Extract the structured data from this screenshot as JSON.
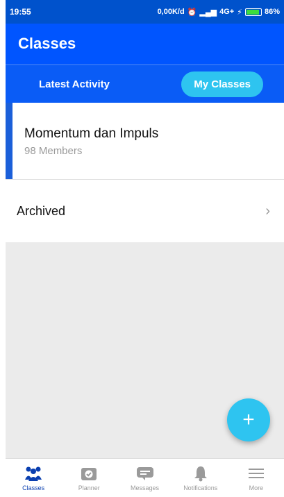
{
  "status_bar": {
    "time": "19:55",
    "network_speed": "0,00K/d",
    "network_type": "4G+",
    "battery": "86%"
  },
  "app_bar": {
    "title": "Classes"
  },
  "tabs": [
    {
      "label": "Latest Activity",
      "active": false
    },
    {
      "label": "My Classes",
      "active": true
    }
  ],
  "class_card": {
    "name": "Momentum dan Impuls",
    "members": "98 Members"
  },
  "archived": {
    "label": "Archived"
  },
  "fab": {
    "icon": "plus-icon",
    "symbol": "+"
  },
  "bottom_nav": [
    {
      "label": "Classes",
      "icon": "classes-icon",
      "active": true
    },
    {
      "label": "Planner",
      "icon": "planner-icon",
      "active": false
    },
    {
      "label": "Messages",
      "icon": "messages-icon",
      "active": false
    },
    {
      "label": "Notifications",
      "icon": "bell-icon",
      "active": false
    },
    {
      "label": "More",
      "icon": "menu-icon",
      "active": false
    }
  ],
  "colors": {
    "primary": "#0055ff",
    "accent": "#2ec4f0",
    "status_bar": "#0052cc"
  }
}
